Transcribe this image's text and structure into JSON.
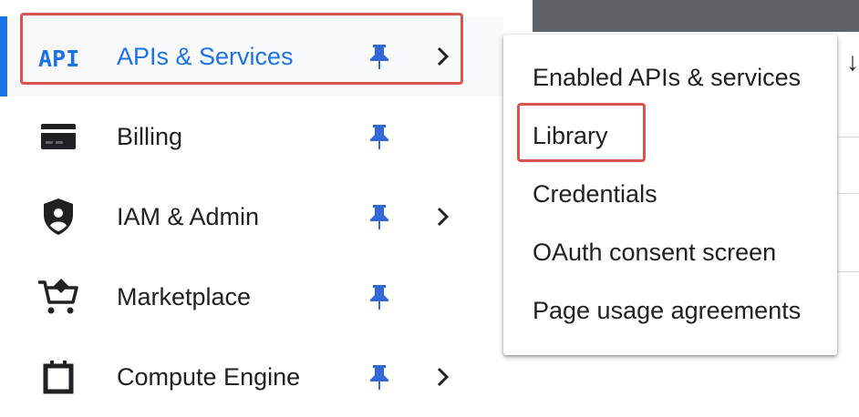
{
  "nav": {
    "items": [
      {
        "label": "APIs & Services",
        "icon": "api-icon",
        "pinned": true,
        "has_submenu": true,
        "active": true
      },
      {
        "label": "Billing",
        "icon": "billing-card-icon",
        "pinned": true,
        "has_submenu": false,
        "active": false
      },
      {
        "label": "IAM & Admin",
        "icon": "shield-user-icon",
        "pinned": true,
        "has_submenu": true,
        "active": false
      },
      {
        "label": "Marketplace",
        "icon": "cart-icon",
        "pinned": true,
        "has_submenu": false,
        "active": false
      },
      {
        "label": "Compute Engine",
        "icon": "chip-icon",
        "pinned": true,
        "has_submenu": true,
        "active": false
      }
    ],
    "api_icon_text": "API"
  },
  "submenu": {
    "items": [
      {
        "label": "Enabled APIs & services"
      },
      {
        "label": "Library"
      },
      {
        "label": "Credentials"
      },
      {
        "label": "OAuth consent screen"
      },
      {
        "label": "Page usage agreements"
      }
    ]
  },
  "colors": {
    "accent": "#1a73e8",
    "highlight": "#d9534f",
    "pin": "#3367d6",
    "text": "#202124"
  }
}
